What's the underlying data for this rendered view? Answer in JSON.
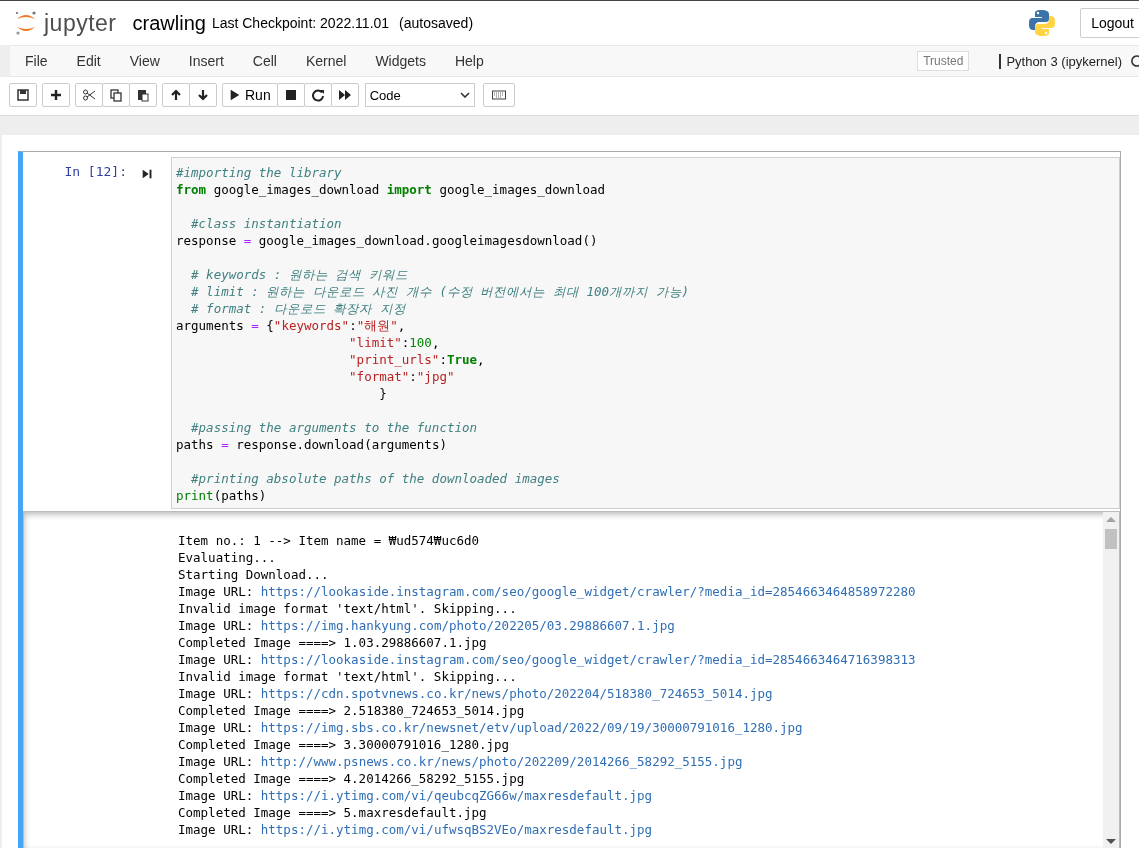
{
  "header": {
    "logo_text": "jupyter",
    "notebook_name": "crawling",
    "checkpoint": "Last Checkpoint: 2022.11.01",
    "autosave": "(autosaved)",
    "logout": "Logout"
  },
  "menu": [
    "File",
    "Edit",
    "View",
    "Insert",
    "Cell",
    "Kernel",
    "Widgets",
    "Help"
  ],
  "trusted": "Trusted",
  "kernel": "Python 3 (ipykernel)",
  "toolbar": {
    "run": "Run",
    "cell_type": "Code"
  },
  "cell": {
    "prompt": "In [12]:",
    "selected": true,
    "code": [
      {
        "gap_before": false,
        "tokens": [
          {
            "kind": "comment",
            "text": "#importing the library"
          }
        ]
      },
      {
        "gap_before": false,
        "tokens": [
          {
            "kind": "keyword",
            "text": "from"
          },
          {
            "kind": "plain",
            "text": " google_images_download "
          },
          {
            "kind": "keyword",
            "text": "import"
          },
          {
            "kind": "plain",
            "text": " google_images_download"
          }
        ]
      },
      {
        "gap_before": true,
        "tokens": [
          {
            "kind": "comment",
            "text": "  #class instantiation"
          }
        ]
      },
      {
        "gap_before": false,
        "tokens": [
          {
            "kind": "plain",
            "text": "response "
          },
          {
            "kind": "op",
            "text": "="
          },
          {
            "kind": "plain",
            "text": " google_images_download.googleimagesdownload()"
          }
        ]
      },
      {
        "gap_before": true,
        "tokens": [
          {
            "kind": "comment",
            "text": "  # keywords : 원하는 검색 키워드"
          }
        ]
      },
      {
        "gap_before": false,
        "tokens": [
          {
            "kind": "comment",
            "text": "  # limit : 원하는 다운로드 사진 개수 (수정 버전에서는 최대 100개까지 가능)"
          }
        ]
      },
      {
        "gap_before": false,
        "tokens": [
          {
            "kind": "comment",
            "text": "  # format : 다운로드 확장자 지정"
          }
        ]
      },
      {
        "gap_before": false,
        "tokens": [
          {
            "kind": "plain",
            "text": "arguments "
          },
          {
            "kind": "op",
            "text": "="
          },
          {
            "kind": "plain",
            "text": " {"
          },
          {
            "kind": "string",
            "text": "\"keywords\""
          },
          {
            "kind": "plain",
            "text": ":"
          },
          {
            "kind": "string",
            "text": "\"해원\""
          },
          {
            "kind": "plain",
            "text": ","
          }
        ]
      },
      {
        "gap_before": false,
        "tokens": [
          {
            "kind": "string",
            "text": "                       \"limit\""
          },
          {
            "kind": "plain",
            "text": ":"
          },
          {
            "kind": "number",
            "text": "100"
          },
          {
            "kind": "plain",
            "text": ","
          }
        ]
      },
      {
        "gap_before": false,
        "tokens": [
          {
            "kind": "string",
            "text": "                       \"print_urls\""
          },
          {
            "kind": "plain",
            "text": ":"
          },
          {
            "kind": "keyword",
            "text": "True"
          },
          {
            "kind": "plain",
            "text": ","
          }
        ]
      },
      {
        "gap_before": false,
        "tokens": [
          {
            "kind": "string",
            "text": "                       \"format\""
          },
          {
            "kind": "plain",
            "text": ":"
          },
          {
            "kind": "string",
            "text": "\"jpg\""
          }
        ]
      },
      {
        "gap_before": false,
        "tokens": [
          {
            "kind": "plain",
            "text": "                           }"
          }
        ]
      },
      {
        "gap_before": true,
        "tokens": [
          {
            "kind": "comment",
            "text": "  #passing the arguments to the function"
          }
        ]
      },
      {
        "gap_before": false,
        "tokens": [
          {
            "kind": "plain",
            "text": "paths "
          },
          {
            "kind": "op",
            "text": "="
          },
          {
            "kind": "plain",
            "text": " response.download(arguments)"
          }
        ]
      },
      {
        "gap_before": true,
        "tokens": [
          {
            "kind": "comment",
            "text": "  #printing absolute paths of the downloaded images"
          }
        ]
      },
      {
        "gap_before": false,
        "tokens": [
          {
            "kind": "builtin",
            "text": "print"
          },
          {
            "kind": "plain",
            "text": "(paths)"
          }
        ]
      }
    ],
    "output": [
      {
        "text": "Item no.: 1 --> Item name = ₩ud574₩uc6d0"
      },
      {
        "text": "Evaluating..."
      },
      {
        "text": "Starting Download..."
      },
      {
        "text": "Image URL: ",
        "url": "https://lookaside.instagram.com/seo/google_widget/crawler/?media_id=2854663464858972280"
      },
      {
        "text": "Invalid image format 'text/html'. Skipping..."
      },
      {
        "text": "Image URL: ",
        "url": "https://img.hankyung.com/photo/202205/03.29886607.1.jpg"
      },
      {
        "text": "Completed Image ====> 1.03.29886607.1.jpg"
      },
      {
        "text": "Image URL: ",
        "url": "https://lookaside.instagram.com/seo/google_widget/crawler/?media_id=2854663464716398313"
      },
      {
        "text": "Invalid image format 'text/html'. Skipping..."
      },
      {
        "text": "Image URL: ",
        "url": "https://cdn.spotvnews.co.kr/news/photo/202204/518380_724653_5014.jpg"
      },
      {
        "text": "Completed Image ====> 2.518380_724653_5014.jpg"
      },
      {
        "text": "Image URL: ",
        "url": "https://img.sbs.co.kr/newsnet/etv/upload/2022/09/19/30000791016_1280.jpg"
      },
      {
        "text": "Completed Image ====> 3.30000791016_1280.jpg"
      },
      {
        "text": "Image URL: ",
        "url": "http://www.psnews.co.kr/news/photo/202209/2014266_58292_5155.jpg"
      },
      {
        "text": "Completed Image ====> 4.2014266_58292_5155.jpg"
      },
      {
        "text": "Image URL: ",
        "url": "https://i.ytimg.com/vi/qeubcqZG66w/maxresdefault.jpg"
      },
      {
        "text": "Completed Image ====> 5.maxresdefault.jpg"
      },
      {
        "text": "Image URL: ",
        "url": "https://i.ytimg.com/vi/ufwsqBS2VEo/maxresdefault.jpg"
      }
    ]
  }
}
